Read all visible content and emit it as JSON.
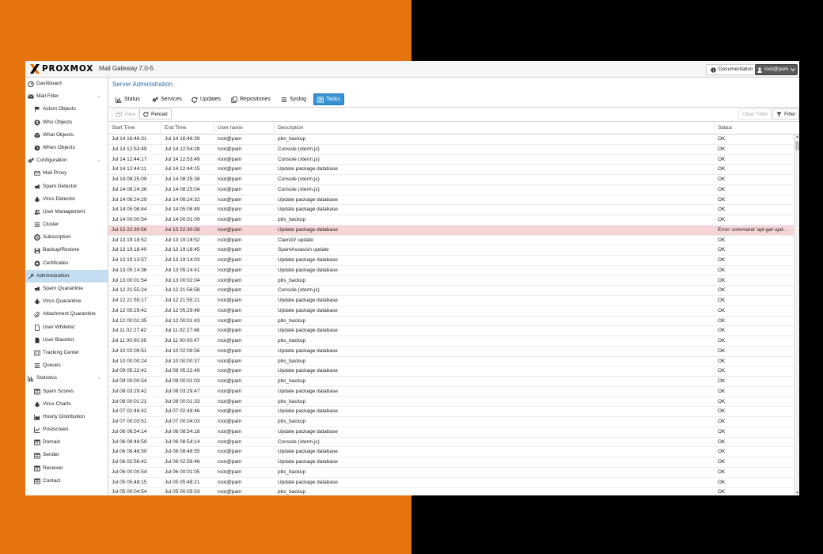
{
  "app": {
    "brand": "PROXMOX",
    "product_title": "Mail Gateway 7.0-5",
    "documentation_label": "Documentation",
    "user_label": "root@pam"
  },
  "colors": {
    "accent": "#3892d4",
    "title_link": "#2c6eb0",
    "sidebar_selected": "#c2ddf2",
    "error_row": "#f5d5d5",
    "brand_orange": "#e57000"
  },
  "sidebar": {
    "items": [
      {
        "label": "Dashboard",
        "level": 1,
        "icon": "dashboard-icon"
      },
      {
        "label": "Mail Filter",
        "level": 1,
        "icon": "envelope-icon",
        "expanded": true
      },
      {
        "label": "Action Objects",
        "level": 2,
        "icon": "flag-icon"
      },
      {
        "label": "Who Objects",
        "level": 2,
        "icon": "user-circle-icon"
      },
      {
        "label": "What Objects",
        "level": 2,
        "icon": "cube-icon"
      },
      {
        "label": "When Objects",
        "level": 2,
        "icon": "clock-icon"
      },
      {
        "label": "Configuration",
        "level": 1,
        "icon": "cogs-icon",
        "expanded": true
      },
      {
        "label": "Mail Proxy",
        "level": 2,
        "icon": "envelope-o-icon"
      },
      {
        "label": "Spam Detector",
        "level": 2,
        "icon": "bullhorn-icon"
      },
      {
        "label": "Virus Detector",
        "level": 2,
        "icon": "bug-icon"
      },
      {
        "label": "User Management",
        "level": 2,
        "icon": "users-icon"
      },
      {
        "label": "Cluster",
        "level": 2,
        "icon": "list-icon"
      },
      {
        "label": "Subscription",
        "level": 2,
        "icon": "support-icon"
      },
      {
        "label": "Backup/Restore",
        "level": 2,
        "icon": "floppy-icon"
      },
      {
        "label": "Certificates",
        "level": 2,
        "icon": "certificate-icon"
      },
      {
        "label": "Administration",
        "level": 1,
        "icon": "wrench-icon",
        "selected": true
      },
      {
        "label": "Spam Quarantine",
        "level": 2,
        "icon": "bullhorn-icon"
      },
      {
        "label": "Virus Quarantine",
        "level": 2,
        "icon": "bug-icon"
      },
      {
        "label": "Attachment Quarantine",
        "level": 2,
        "icon": "paperclip-icon"
      },
      {
        "label": "User Whitelist",
        "level": 2,
        "icon": "file-o-icon"
      },
      {
        "label": "User Blacklist",
        "level": 2,
        "icon": "file-icon"
      },
      {
        "label": "Tracking Center",
        "level": 2,
        "icon": "map-o-icon"
      },
      {
        "label": "Queues",
        "level": 2,
        "icon": "bars-icon"
      },
      {
        "label": "Statistics",
        "level": 1,
        "icon": "bar-chart-icon",
        "expanded": true
      },
      {
        "label": "Spam Scores",
        "level": 2,
        "icon": "table-icon"
      },
      {
        "label": "Virus Charts",
        "level": 2,
        "icon": "bug-icon"
      },
      {
        "label": "Hourly Distribution",
        "level": 2,
        "icon": "area-chart-icon"
      },
      {
        "label": "Postscreen",
        "level": 2,
        "icon": "line-chart-icon"
      },
      {
        "label": "Domain",
        "level": 2,
        "icon": "table-icon"
      },
      {
        "label": "Sender",
        "level": 2,
        "icon": "table-icon"
      },
      {
        "label": "Receiver",
        "level": 2,
        "icon": "table-icon"
      },
      {
        "label": "Contact",
        "level": 2,
        "icon": "table-icon"
      }
    ]
  },
  "main": {
    "panel_title": "Server Administration",
    "tabs": [
      {
        "label": "Status",
        "icon": "bar-chart-icon"
      },
      {
        "label": "Services",
        "icon": "cogs-icon"
      },
      {
        "label": "Updates",
        "icon": "refresh-icon"
      },
      {
        "label": "Repositories",
        "icon": "files-icon"
      },
      {
        "label": "Syslog",
        "icon": "list-icon"
      },
      {
        "label": "Tasks",
        "icon": "list-alt-icon",
        "active": true
      }
    ],
    "toolbar": {
      "view_label": "View",
      "reload_label": "Reload",
      "clear_filter_label": "Clear Filter",
      "filter_label": "Filter"
    },
    "columns": [
      "Start Time",
      "End Time",
      "User name",
      "Description",
      "Status"
    ],
    "rows": [
      [
        "Jul 14 16:46:31",
        "Jul 14 16:46:39",
        "root@pam",
        "pbs_backup",
        "OK"
      ],
      [
        "Jul 14 12:53:49",
        "Jul 14 12:54:28",
        "root@pam",
        "Console (xterm.js)",
        "OK"
      ],
      [
        "Jul 14 12:44:17",
        "Jul 14 12:53:49",
        "root@pam",
        "Console (xterm.js)",
        "OK"
      ],
      [
        "Jul 14 12:44:11",
        "Jul 14 12:44:15",
        "root@pam",
        "Update package database",
        "OK"
      ],
      [
        "Jul 14 08:25:09",
        "Jul 14 08:25:38",
        "root@pam",
        "Console (xterm.js)",
        "OK"
      ],
      [
        "Jul 14 08:24:36",
        "Jul 14 08:25:04",
        "root@pam",
        "Console (xterm.js)",
        "OK"
      ],
      [
        "Jul 14 08:24:29",
        "Jul 14 08:24:32",
        "root@pam",
        "Update package database",
        "OK"
      ],
      [
        "Jul 14 05:08:44",
        "Jul 14 05:08:49",
        "root@pam",
        "Update package database",
        "OK"
      ],
      [
        "Jul 14 00:00:54",
        "Jul 14 00:01:09",
        "root@pam",
        "pbs_backup",
        "OK"
      ],
      [
        "Jul 13 22:30:56",
        "Jul 13 22:30:58",
        "root@pam",
        "Update package database",
        "Error: command 'apt-get upd..."
      ],
      [
        "Jul 13 19:18:52",
        "Jul 13 19:18:52",
        "root@pam",
        "ClamAV update",
        "OK"
      ],
      [
        "Jul 13 19:18:40",
        "Jul 13 19:18:45",
        "root@pam",
        "SpamAssassin update",
        "OK"
      ],
      [
        "Jul 13 19:13:57",
        "Jul 13 19:14:03",
        "root@pam",
        "Update package database",
        "OK"
      ],
      [
        "Jul 13 05:14:36",
        "Jul 13 05:14:41",
        "root@pam",
        "Update package database",
        "OK"
      ],
      [
        "Jul 13 00:01:54",
        "Jul 13 00:02:04",
        "root@pam",
        "pbs_backup",
        "OK"
      ],
      [
        "Jul 12 21:55:24",
        "Jul 12 21:56:58",
        "root@pam",
        "Console (xterm.js)",
        "OK"
      ],
      [
        "Jul 12 21:55:17",
        "Jul 12 21:55:21",
        "root@pam",
        "Update package database",
        "OK"
      ],
      [
        "Jul 12 05:29:42",
        "Jul 12 05:29:48",
        "root@pam",
        "Update package database",
        "OK"
      ],
      [
        "Jul 12 00:01:35",
        "Jul 12 00:01:43",
        "root@pam",
        "pbs_backup",
        "OK"
      ],
      [
        "Jul 11 02:27:42",
        "Jul 11 02:27:48",
        "root@pam",
        "Update package database",
        "OK"
      ],
      [
        "Jul 11 00:00:39",
        "Jul 11 00:00:47",
        "root@pam",
        "pbs_backup",
        "OK"
      ],
      [
        "Jul 10 02:09:51",
        "Jul 10 02:09:56",
        "root@pam",
        "Update package database",
        "OK"
      ],
      [
        "Jul 10 00:00:24",
        "Jul 10 00:00:37",
        "root@pam",
        "pbs_backup",
        "OK"
      ],
      [
        "Jul 09 05:22:42",
        "Jul 09 05:22:49",
        "root@pam",
        "Update package database",
        "OK"
      ],
      [
        "Jul 09 00:00:54",
        "Jul 09 00:01:03",
        "root@pam",
        "pbs_backup",
        "OK"
      ],
      [
        "Jul 08 03:29:42",
        "Jul 08 03:29:47",
        "root@pam",
        "Update package database",
        "OK"
      ],
      [
        "Jul 08 00:01:21",
        "Jul 08 00:01:33",
        "root@pam",
        "pbs_backup",
        "OK"
      ],
      [
        "Jul 07 02:48:42",
        "Jul 07 02:48:46",
        "root@pam",
        "Update package database",
        "OK"
      ],
      [
        "Jul 07 00:03:51",
        "Jul 07 00:04:03",
        "root@pam",
        "pbs_backup",
        "OK"
      ],
      [
        "Jul 06 08:54:14",
        "Jul 06 08:54:18",
        "root@pam",
        "Update package database",
        "OK"
      ],
      [
        "Jul 06 08:48:59",
        "Jul 06 08:54:14",
        "root@pam",
        "Console (xterm.js)",
        "OK"
      ],
      [
        "Jul 06 08:48:50",
        "Jul 06 08:48:55",
        "root@pam",
        "Update package database",
        "OK"
      ],
      [
        "Jul 06 02:56:42",
        "Jul 06 02:56:46",
        "root@pam",
        "Update package database",
        "OK"
      ],
      [
        "Jul 06 00:00:54",
        "Jul 06 00:01:05",
        "root@pam",
        "pbs_backup",
        "OK"
      ],
      [
        "Jul 05 05:48:15",
        "Jul 05 05:48:21",
        "root@pam",
        "Update package database",
        "OK"
      ],
      [
        "Jul 05 00:04:54",
        "Jul 05 00:05:03",
        "root@pam",
        "pbs_backup",
        "OK"
      ]
    ]
  }
}
